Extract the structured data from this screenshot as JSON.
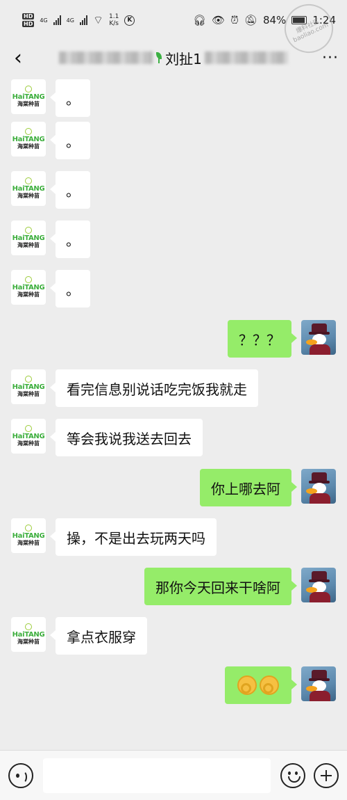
{
  "status_bar": {
    "hd1": "HD",
    "hd2": "HD",
    "net1": "4G",
    "net2": "4G",
    "speed_value": "1.1",
    "speed_unit": "K/s",
    "k_label": "K",
    "battery": "84%",
    "time": "1:24"
  },
  "watermark": {
    "line1": "爆料社区",
    "line2": "baoliao.com"
  },
  "header": {
    "title_visible": "刘扯1",
    "more": "···"
  },
  "contact": {
    "logo_en": "HaiTANG",
    "logo_cn": "海棠种苗"
  },
  "messages": [
    {
      "side": "left",
      "text": "。"
    },
    {
      "side": "left",
      "text": "。"
    },
    {
      "side": "left",
      "text": "。"
    },
    {
      "side": "left",
      "text": "。"
    },
    {
      "side": "left",
      "text": "。"
    },
    {
      "side": "right",
      "text": "？？？"
    },
    {
      "side": "left",
      "text": "看完信息别说话吃完饭我就走"
    },
    {
      "side": "left",
      "text": "等会我说我送去回去"
    },
    {
      "side": "right",
      "text": "你上哪去阿"
    },
    {
      "side": "left",
      "text": "操，不是出去玩两天吗"
    },
    {
      "side": "right",
      "text": "那你今天回来干啥阿"
    },
    {
      "side": "left",
      "text": "拿点衣服穿"
    },
    {
      "side": "right",
      "text": "",
      "emoji": "ok-hand-emoji"
    }
  ],
  "input": {
    "value": "",
    "placeholder": ""
  },
  "colors": {
    "self_bubble": "#95ec69",
    "other_bubble": "#ffffff",
    "background": "#ededed"
  }
}
